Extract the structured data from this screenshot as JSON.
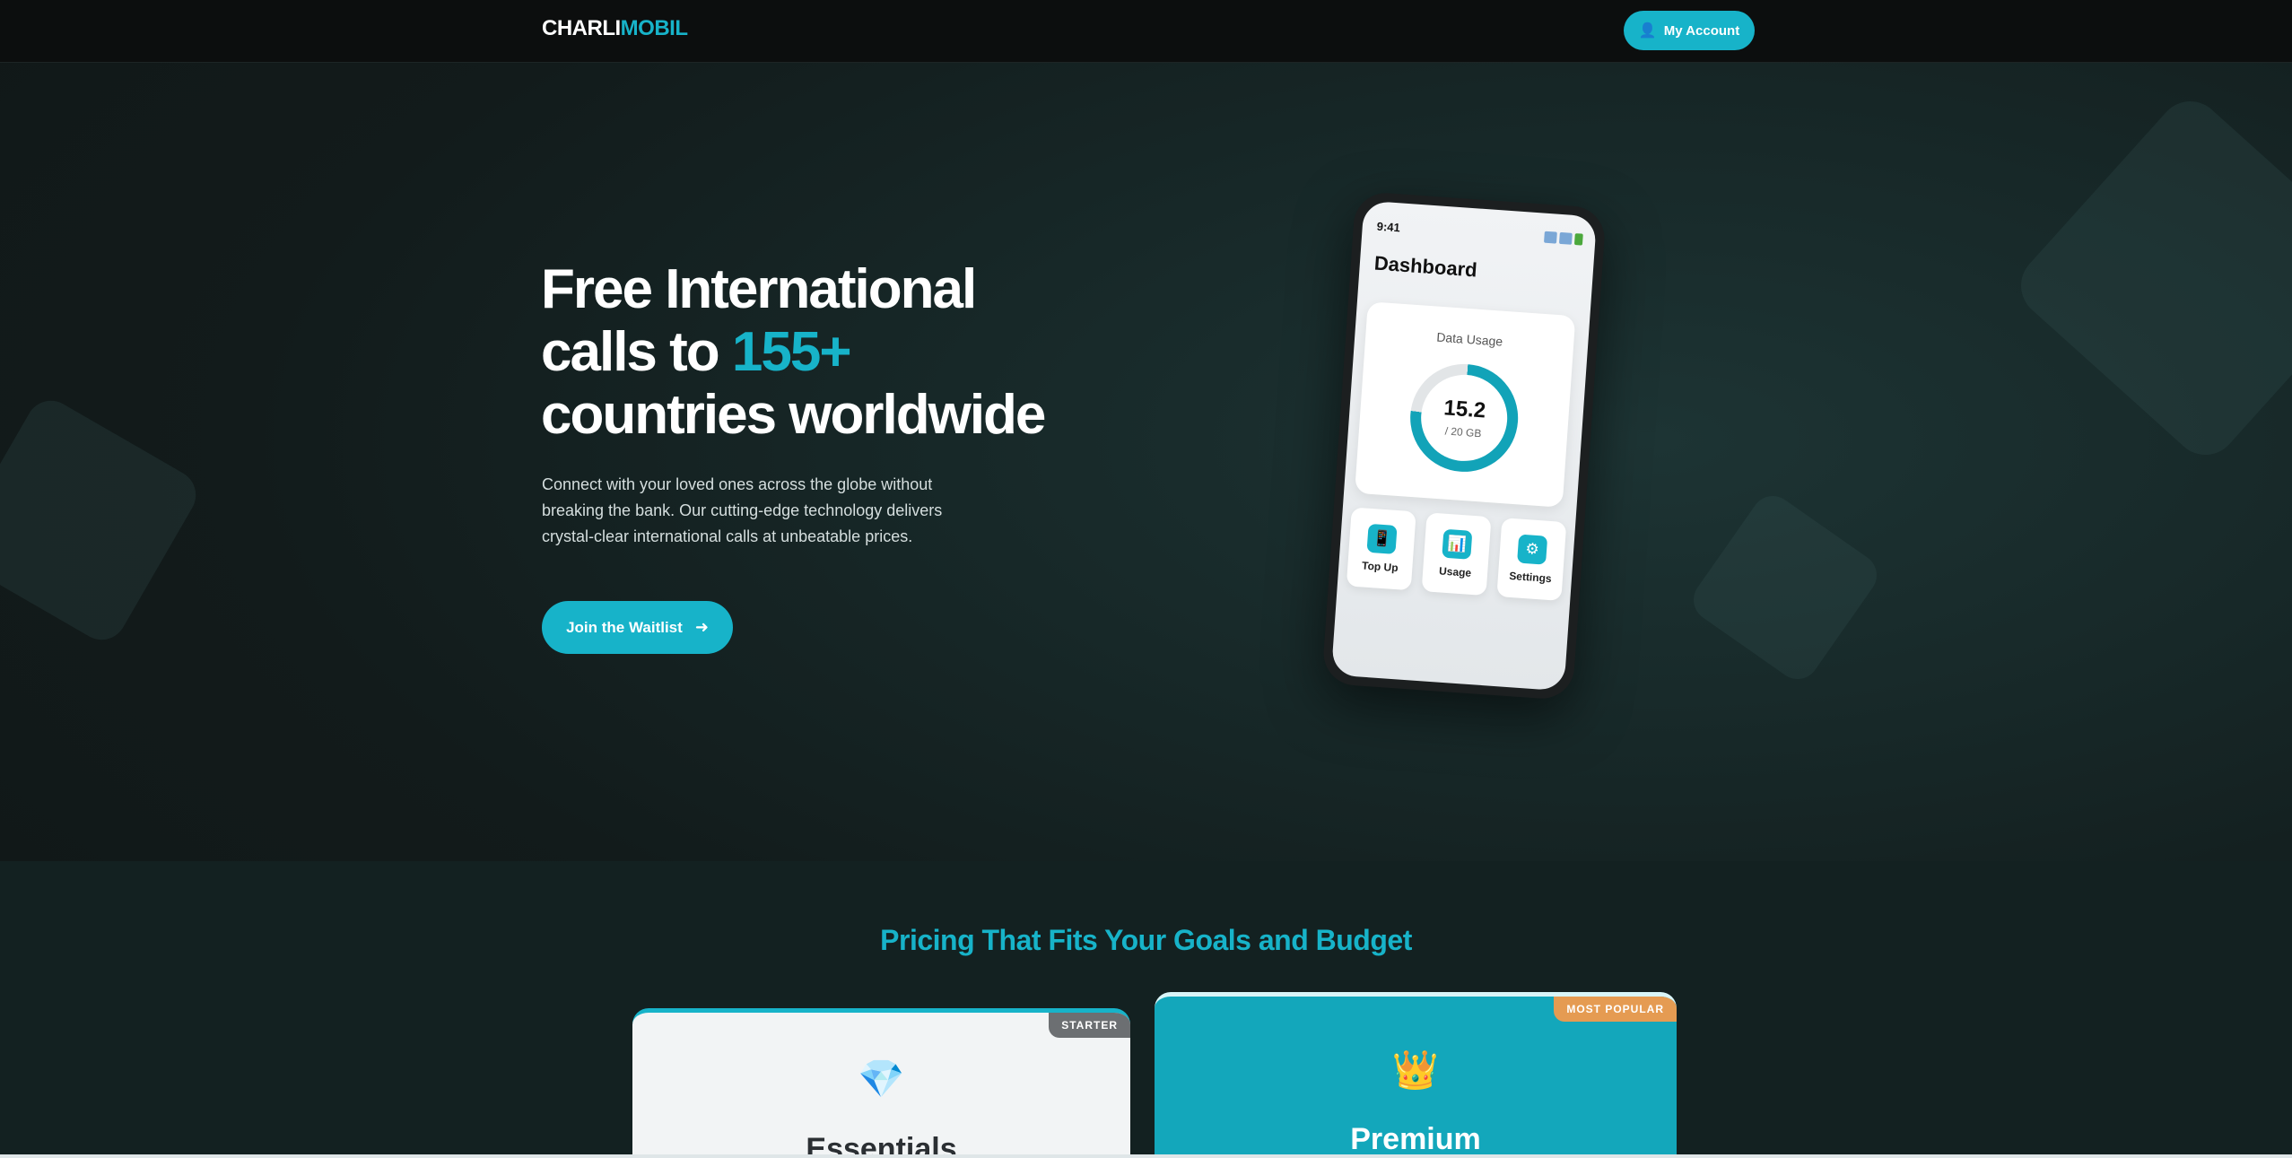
{
  "nav": {
    "logo_part1": "CHARLI",
    "logo_part2": "MOBIL",
    "account_label": "My Account",
    "account_icon": "user-icon"
  },
  "hero": {
    "title_line1": "Free International",
    "title_line2_prefix": "calls to ",
    "title_highlight": "155+",
    "title_line3": "countries worldwide",
    "subtitle": "Connect with your loved ones across the globe without breaking the bank. Our cutting-edge technology delivers crystal-clear international calls at unbeatable prices.",
    "cta_label": "Join the Waitlist",
    "cta_icon": "arrow-right-icon"
  },
  "phone": {
    "time": "9:41",
    "screen_title": "Dashboard",
    "usage_label": "Data Usage",
    "usage_value": "15.2",
    "usage_limit": "/ 20 GB",
    "usage_fraction": 0.76,
    "tiles": [
      {
        "label": "Top Up",
        "icon": "phone-icon"
      },
      {
        "label": "Usage",
        "icon": "bar-chart-icon"
      },
      {
        "label": "Settings",
        "icon": "gear-icon"
      }
    ]
  },
  "pricing": {
    "title": "Pricing That Fits Your Goals and Budget",
    "plans": [
      {
        "name": "Essentials",
        "badge": "STARTER",
        "icon": "diamond-icon"
      },
      {
        "name": "Premium",
        "badge": "MOST POPULAR",
        "icon": "crown-icon"
      }
    ]
  },
  "colors": {
    "accent": "#17b3c9",
    "nav_bg": "#0c0e0e",
    "popular_badge": "#e59b52",
    "starter_badge": "#6c6f72"
  }
}
